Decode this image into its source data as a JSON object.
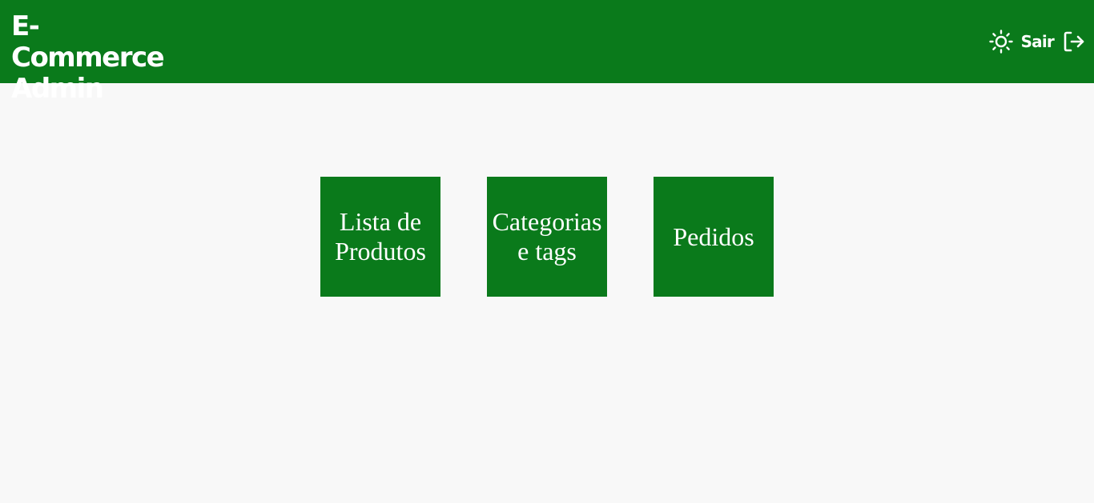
{
  "colors": {
    "brand_green": "#0a7a1b",
    "page_background": "#f8f8f8",
    "text_on_brand": "#ffffff"
  },
  "header": {
    "title": "E-Commerce Admin",
    "theme_toggle_icon": "sun-icon",
    "logout_label": "Sair",
    "logout_icon": "logout-icon"
  },
  "tiles": [
    {
      "label": "Lista de Produtos"
    },
    {
      "label": "Categorias e tags"
    },
    {
      "label": "Pedidos"
    }
  ]
}
